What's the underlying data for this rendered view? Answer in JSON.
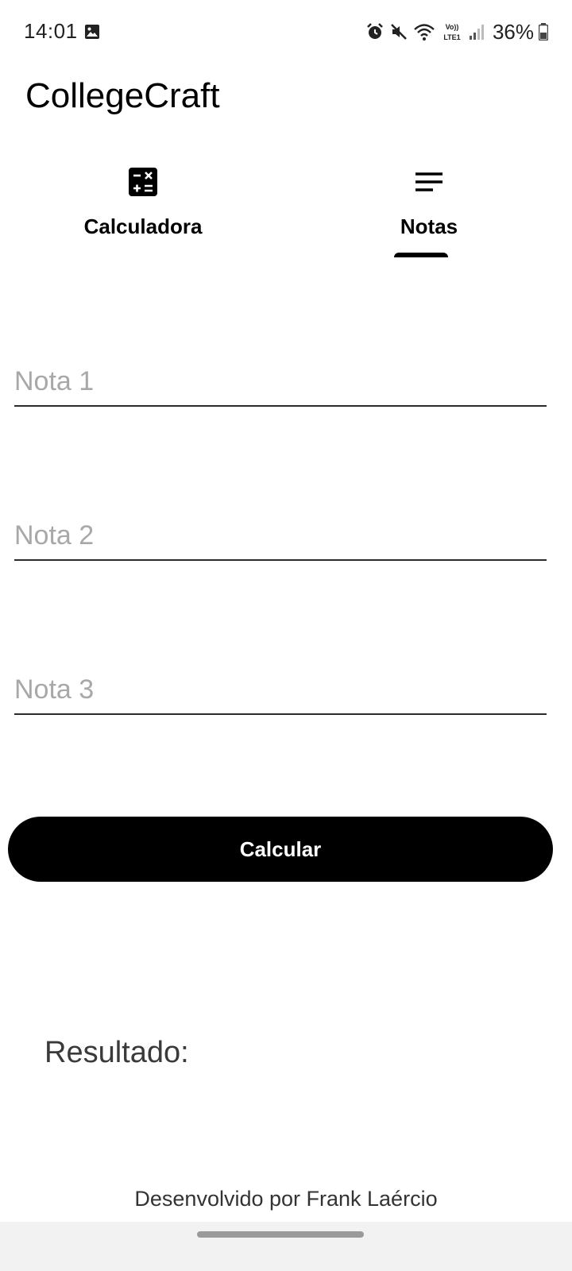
{
  "status_bar": {
    "time": "14:01",
    "battery": "36%",
    "icons": [
      "image-icon",
      "alarm-icon",
      "mute-icon",
      "wifi-icon",
      "volte-icon",
      "signal-icon",
      "battery-icon"
    ],
    "volte_top": "Vo))",
    "volte_bottom": "LTE1"
  },
  "app": {
    "title": "CollegeCraft"
  },
  "tabs": [
    {
      "label": "Calculadora",
      "icon": "calculator-icon",
      "selected": false
    },
    {
      "label": "Notas",
      "icon": "notes-lines-icon",
      "selected": true
    }
  ],
  "form": {
    "fields": [
      {
        "placeholder": "Nota 1",
        "value": ""
      },
      {
        "placeholder": "Nota 2",
        "value": ""
      },
      {
        "placeholder": "Nota 3",
        "value": ""
      }
    ],
    "button_label": "Calcular"
  },
  "result": {
    "label": "Resultado:"
  },
  "footer": {
    "credit": "Desenvolvido por Frank Laércio"
  },
  "colors": {
    "accent": "#000000",
    "background": "#ffffff",
    "placeholder": "#a8a8a8"
  }
}
